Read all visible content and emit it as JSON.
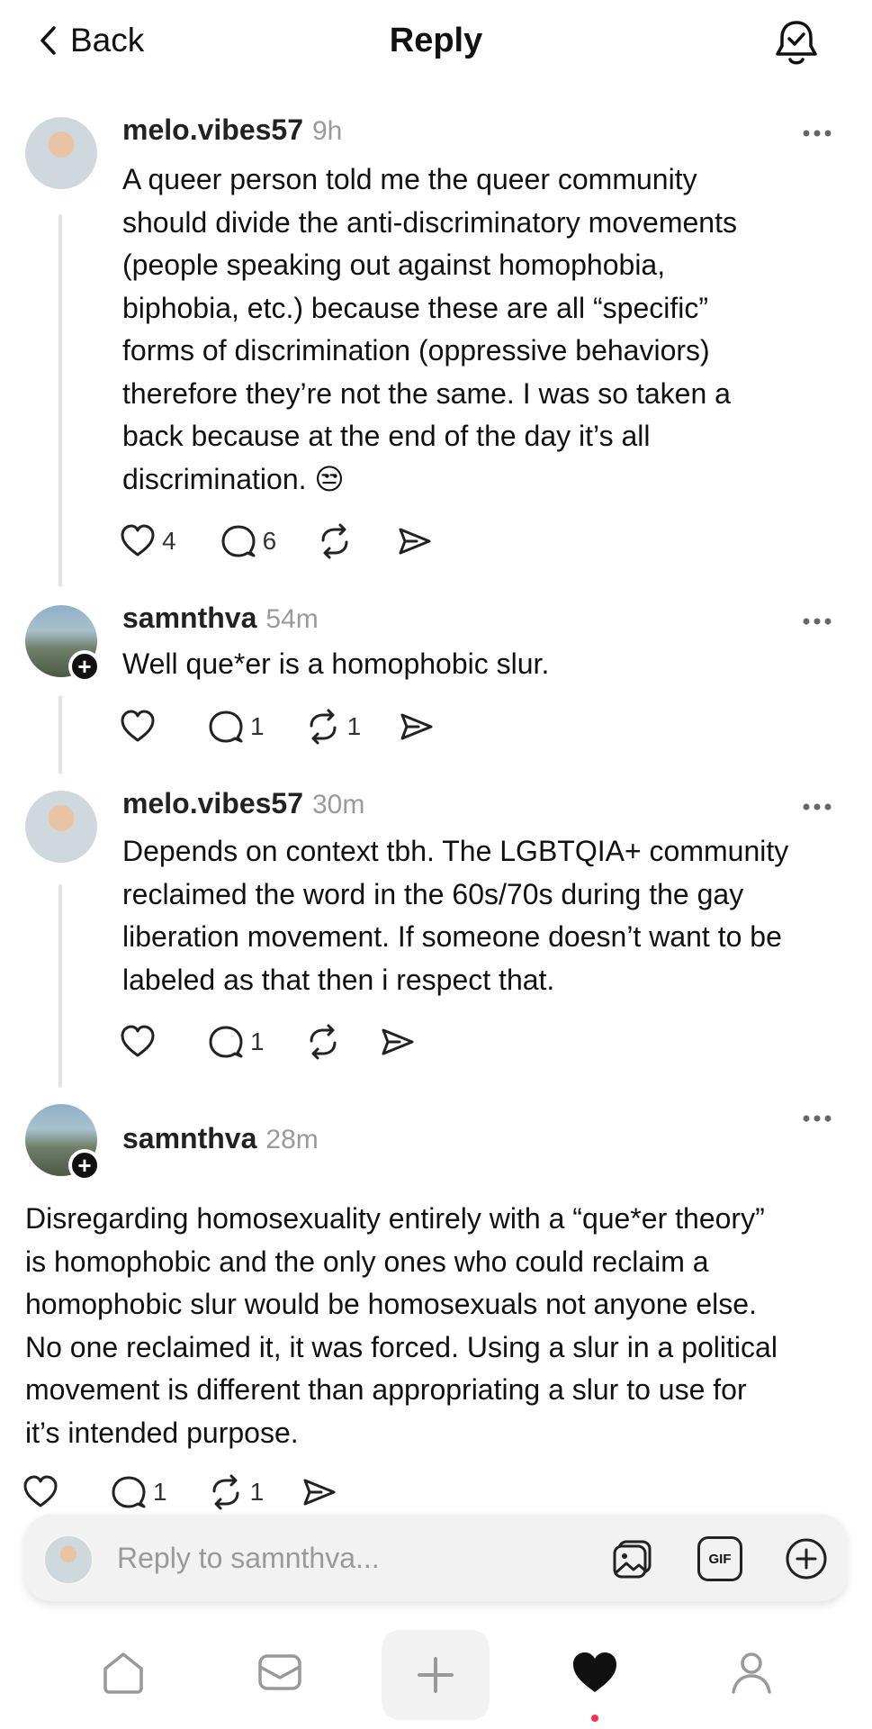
{
  "header": {
    "back_label": "Back",
    "title": "Reply",
    "bell_icon": "bell-check-icon"
  },
  "posts": [
    {
      "username": "melo.vibes57",
      "time": "9h",
      "lines": [
        "A queer person told me the queer community",
        "should divide the anti-discriminatory movements",
        "(people speaking out against homophobia,",
        "biphobia, etc.) because these are all “specific”",
        "forms of discrimination (oppressive behaviors)",
        "therefore they’re not the same. I was so taken a",
        "back because at the end of the day it’s all",
        "discrimination. 😒"
      ],
      "likes": "4",
      "replies": "6",
      "reposts": ""
    },
    {
      "username": "samnthva",
      "time": "54m",
      "lines": [
        "Well que*er is a homophobic slur."
      ],
      "likes": "",
      "replies": "1",
      "reposts": "1"
    },
    {
      "username": "melo.vibes57",
      "time": "30m",
      "lines": [
        "Depends on context tbh. The LGBTQIA+ community",
        "reclaimed the word in the 60s/70s during the gay",
        "liberation movement. If someone doesn’t want to be",
        "labeled as that then i respect that."
      ],
      "likes": "",
      "replies": "1",
      "reposts": ""
    },
    {
      "username": "samnthva",
      "time": "28m",
      "lines": [
        "Disregarding homosexuality entirely with a “que*er theory”",
        "is homophobic and the only ones who could reclaim a",
        "homophobic slur would be homosexuals not anyone else.",
        "No one reclaimed it, it was forced. Using a slur in a political",
        "movement is different than appropriating a slur to use for",
        "it’s intended purpose."
      ],
      "likes": "",
      "replies": "1",
      "reposts": "1"
    }
  ],
  "reply_box": {
    "placeholder": "Reply to samnthva...",
    "gif_label": "GIF"
  },
  "nav": {
    "items": [
      "home-icon",
      "inbox-icon",
      "compose-icon",
      "activity-heart-icon",
      "profile-icon"
    ],
    "active": "activity-heart-icon"
  },
  "colors": {
    "text": "#111111",
    "muted": "#9a9a9a",
    "thread_line": "#e3e3e3",
    "notification_dot": "#ff2d55"
  }
}
